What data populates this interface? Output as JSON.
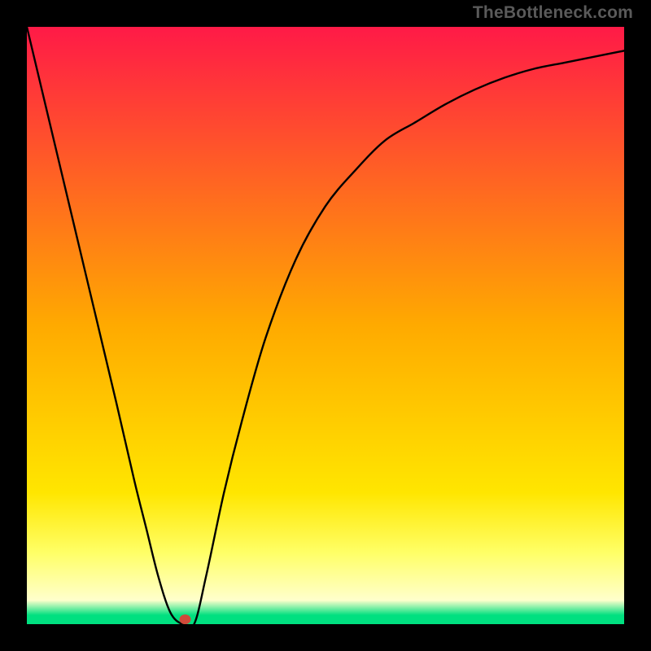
{
  "attribution": "TheBottleneck.com",
  "chart_data": {
    "type": "line",
    "title": "",
    "xlabel": "",
    "ylabel": "",
    "xlim": [
      0,
      100
    ],
    "ylim": [
      0,
      100
    ],
    "background_gradient": {
      "stops": [
        {
          "offset": 0.0,
          "color": "#ff1a47"
        },
        {
          "offset": 0.5,
          "color": "#ffaa00"
        },
        {
          "offset": 0.78,
          "color": "#ffe600"
        },
        {
          "offset": 0.88,
          "color": "#ffff66"
        },
        {
          "offset": 0.96,
          "color": "#ffffcc"
        },
        {
          "offset": 0.985,
          "color": "#00e080"
        }
      ]
    },
    "series": [
      {
        "name": "bottleneck-curve",
        "color": "#000000",
        "x": [
          0,
          5,
          10,
          15,
          18,
          20,
          22,
          24,
          26,
          28,
          30,
          33,
          36,
          40,
          45,
          50,
          55,
          60,
          65,
          70,
          75,
          80,
          85,
          90,
          95,
          100
        ],
        "values": [
          100,
          79,
          58,
          37,
          24,
          16,
          8,
          2,
          0,
          0,
          8,
          22,
          34,
          48,
          61,
          70,
          76,
          81,
          84,
          87,
          89.5,
          91.5,
          93,
          94,
          95,
          96
        ]
      }
    ],
    "marker": {
      "x": 26.5,
      "y": 0.8,
      "color": "#d04a3a",
      "rx": 7,
      "ry": 6
    }
  }
}
